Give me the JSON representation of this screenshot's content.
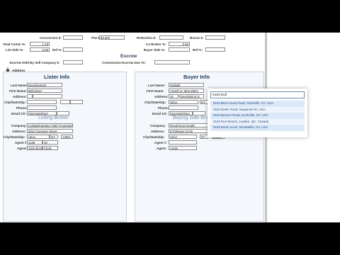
{
  "top": {
    "concession_label": "Concession $:",
    "flat_label": "Flat $:",
    "flat_value": "$2,500",
    "reduction_label": "Reduction $:",
    "bonus_label": "Bonus $:"
  },
  "commission": {
    "total_label": "Total Comm %:",
    "total_value": "1.15",
    "list_side_label": "List Side %:",
    "list_side_value": "0.65",
    "ref_label": "Ref %:",
    "co_broker_label": "Co Broker %:",
    "co_broker_value": "0.65",
    "buyer_side_label": "Buyer Side %:",
    "ref2_label": "Ref %:"
  },
  "escrow": {
    "title": "Escrow",
    "held_label": "Escrow Held By Sell Company $:",
    "due_label": "Commission Escrow Due To:"
  },
  "address_button": {
    "label": "Address"
  },
  "lister": {
    "title": "Lister Info",
    "last_name_label": "Last Name:",
    "last_name_value": "Development",
    "first_name_label": "First Name:",
    "first_name_value": "Bebsinger",
    "address_label": "Address:",
    "city_state_zip_label": "City/State/Zip:",
    "phone_label": "Phone:",
    "email_label": "Email 1/2:",
    "email_value": "fdorrisdsi@aol"
  },
  "listing_broker": {
    "title": "Listing Broker",
    "company_label": "Company:",
    "company_value": "Coldwell Banker Faith Properties",
    "address_label": "Address:",
    "address_value": "2011 Genesee Street",
    "city_state_zip_label": "City/State/Zip:",
    "city_value": "Utica",
    "state_value": "NY",
    "zip_value": "13501",
    "agent_num_label": "Agent #:",
    "agent_num_value": "1128",
    "agent_num2_value": "49",
    "agent_label": "Agent:",
    "agent_value": "John Brown",
    "agent2_value": "Cindy"
  },
  "buyer": {
    "title": "Buyer Info",
    "last_name_label": "Last Name:",
    "last_name_value": "Gigliotti",
    "first_name_label": "First Name:",
    "first_name_value": "Angelo & Jana Marie",
    "address_label": "Address:",
    "address_num_value": "10",
    "address_street_value": "Deerfield Dr E",
    "city_state_zip_label": "City/State/Zip:",
    "city_value": "Utica",
    "state_value": "NY",
    "phone_label": "Phone:",
    "email_label": "Email 1/2:",
    "email_value": "fdorrisdsi@aol"
  },
  "buying_broker": {
    "title": "Buying Side Broker",
    "company_label": "Company:",
    "company_value": "Royal Ross Realty",
    "address_label": "Address:",
    "address_value": "8 Parkway Circle",
    "city_state_zip_label": "City/State/Zip:",
    "city_value": "Utica",
    "state_value": "NY",
    "zip_value": "13501",
    "agent_num_label": "Agent #:",
    "agent_label": "Agent:",
    "agent_value": "Angie"
  },
  "autocomplete": {
    "query": "9163 Bull",
    "options": [
      "9163 Bear Creek Road, Northville, NY, USA",
      "9163 Butler Road, Saugerutt NY, USA",
      "9163 Benson Road, Northville, NY, USA",
      "9163 Rue Bérard, Lavalée, QC, Canada",
      "9163 Bond Lunch, Broadalbin, NY, USA"
    ]
  }
}
